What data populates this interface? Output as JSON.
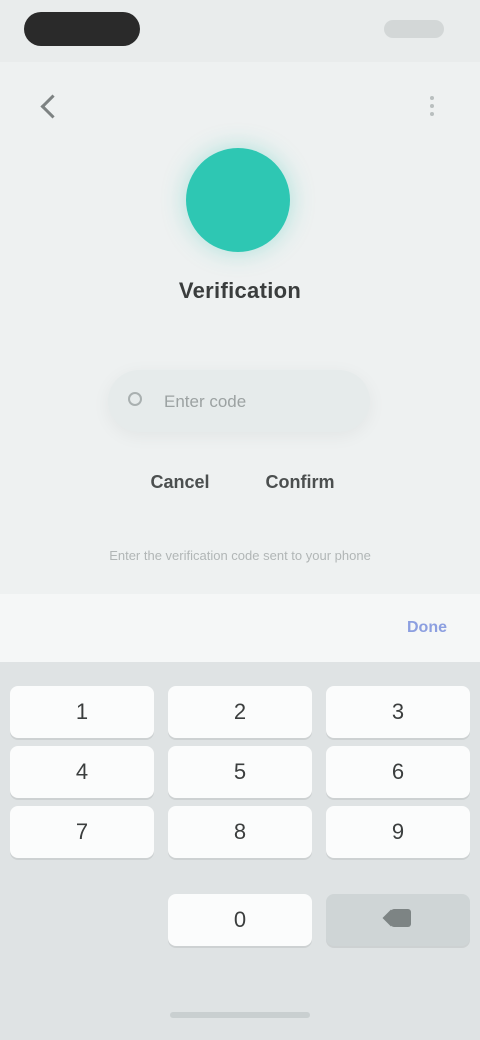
{
  "profile": {
    "name": "Verification",
    "accent_color": "#2ec7b3"
  },
  "input": {
    "placeholder": "Enter code",
    "value": ""
  },
  "actions": {
    "left_label": "Cancel",
    "right_label": "Confirm"
  },
  "help": {
    "text": "Enter the verification code sent to your phone"
  },
  "keyboard": {
    "done_label": "Done",
    "keys": [
      "1",
      "2",
      "3",
      "4",
      "5",
      "6",
      "7",
      "8",
      "9",
      "0"
    ]
  },
  "icons": {
    "back": "back-icon",
    "more": "more-icon",
    "delete": "delete-icon",
    "input": "search-icon"
  }
}
